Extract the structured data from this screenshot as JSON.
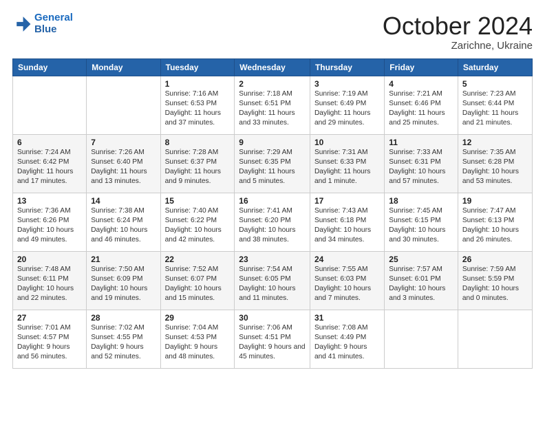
{
  "header": {
    "logo_line1": "General",
    "logo_line2": "Blue",
    "month": "October 2024",
    "location": "Zarichne, Ukraine"
  },
  "weekdays": [
    "Sunday",
    "Monday",
    "Tuesday",
    "Wednesday",
    "Thursday",
    "Friday",
    "Saturday"
  ],
  "weeks": [
    [
      {
        "day": "",
        "info": ""
      },
      {
        "day": "",
        "info": ""
      },
      {
        "day": "1",
        "info": "Sunrise: 7:16 AM\nSunset: 6:53 PM\nDaylight: 11 hours and 37 minutes."
      },
      {
        "day": "2",
        "info": "Sunrise: 7:18 AM\nSunset: 6:51 PM\nDaylight: 11 hours and 33 minutes."
      },
      {
        "day": "3",
        "info": "Sunrise: 7:19 AM\nSunset: 6:49 PM\nDaylight: 11 hours and 29 minutes."
      },
      {
        "day": "4",
        "info": "Sunrise: 7:21 AM\nSunset: 6:46 PM\nDaylight: 11 hours and 25 minutes."
      },
      {
        "day": "5",
        "info": "Sunrise: 7:23 AM\nSunset: 6:44 PM\nDaylight: 11 hours and 21 minutes."
      }
    ],
    [
      {
        "day": "6",
        "info": "Sunrise: 7:24 AM\nSunset: 6:42 PM\nDaylight: 11 hours and 17 minutes."
      },
      {
        "day": "7",
        "info": "Sunrise: 7:26 AM\nSunset: 6:40 PM\nDaylight: 11 hours and 13 minutes."
      },
      {
        "day": "8",
        "info": "Sunrise: 7:28 AM\nSunset: 6:37 PM\nDaylight: 11 hours and 9 minutes."
      },
      {
        "day": "9",
        "info": "Sunrise: 7:29 AM\nSunset: 6:35 PM\nDaylight: 11 hours and 5 minutes."
      },
      {
        "day": "10",
        "info": "Sunrise: 7:31 AM\nSunset: 6:33 PM\nDaylight: 11 hours and 1 minute."
      },
      {
        "day": "11",
        "info": "Sunrise: 7:33 AM\nSunset: 6:31 PM\nDaylight: 10 hours and 57 minutes."
      },
      {
        "day": "12",
        "info": "Sunrise: 7:35 AM\nSunset: 6:28 PM\nDaylight: 10 hours and 53 minutes."
      }
    ],
    [
      {
        "day": "13",
        "info": "Sunrise: 7:36 AM\nSunset: 6:26 PM\nDaylight: 10 hours and 49 minutes."
      },
      {
        "day": "14",
        "info": "Sunrise: 7:38 AM\nSunset: 6:24 PM\nDaylight: 10 hours and 46 minutes."
      },
      {
        "day": "15",
        "info": "Sunrise: 7:40 AM\nSunset: 6:22 PM\nDaylight: 10 hours and 42 minutes."
      },
      {
        "day": "16",
        "info": "Sunrise: 7:41 AM\nSunset: 6:20 PM\nDaylight: 10 hours and 38 minutes."
      },
      {
        "day": "17",
        "info": "Sunrise: 7:43 AM\nSunset: 6:18 PM\nDaylight: 10 hours and 34 minutes."
      },
      {
        "day": "18",
        "info": "Sunrise: 7:45 AM\nSunset: 6:15 PM\nDaylight: 10 hours and 30 minutes."
      },
      {
        "day": "19",
        "info": "Sunrise: 7:47 AM\nSunset: 6:13 PM\nDaylight: 10 hours and 26 minutes."
      }
    ],
    [
      {
        "day": "20",
        "info": "Sunrise: 7:48 AM\nSunset: 6:11 PM\nDaylight: 10 hours and 22 minutes."
      },
      {
        "day": "21",
        "info": "Sunrise: 7:50 AM\nSunset: 6:09 PM\nDaylight: 10 hours and 19 minutes."
      },
      {
        "day": "22",
        "info": "Sunrise: 7:52 AM\nSunset: 6:07 PM\nDaylight: 10 hours and 15 minutes."
      },
      {
        "day": "23",
        "info": "Sunrise: 7:54 AM\nSunset: 6:05 PM\nDaylight: 10 hours and 11 minutes."
      },
      {
        "day": "24",
        "info": "Sunrise: 7:55 AM\nSunset: 6:03 PM\nDaylight: 10 hours and 7 minutes."
      },
      {
        "day": "25",
        "info": "Sunrise: 7:57 AM\nSunset: 6:01 PM\nDaylight: 10 hours and 3 minutes."
      },
      {
        "day": "26",
        "info": "Sunrise: 7:59 AM\nSunset: 5:59 PM\nDaylight: 10 hours and 0 minutes."
      }
    ],
    [
      {
        "day": "27",
        "info": "Sunrise: 7:01 AM\nSunset: 4:57 PM\nDaylight: 9 hours and 56 minutes."
      },
      {
        "day": "28",
        "info": "Sunrise: 7:02 AM\nSunset: 4:55 PM\nDaylight: 9 hours and 52 minutes."
      },
      {
        "day": "29",
        "info": "Sunrise: 7:04 AM\nSunset: 4:53 PM\nDaylight: 9 hours and 48 minutes."
      },
      {
        "day": "30",
        "info": "Sunrise: 7:06 AM\nSunset: 4:51 PM\nDaylight: 9 hours and 45 minutes."
      },
      {
        "day": "31",
        "info": "Sunrise: 7:08 AM\nSunset: 4:49 PM\nDaylight: 9 hours and 41 minutes."
      },
      {
        "day": "",
        "info": ""
      },
      {
        "day": "",
        "info": ""
      }
    ]
  ]
}
